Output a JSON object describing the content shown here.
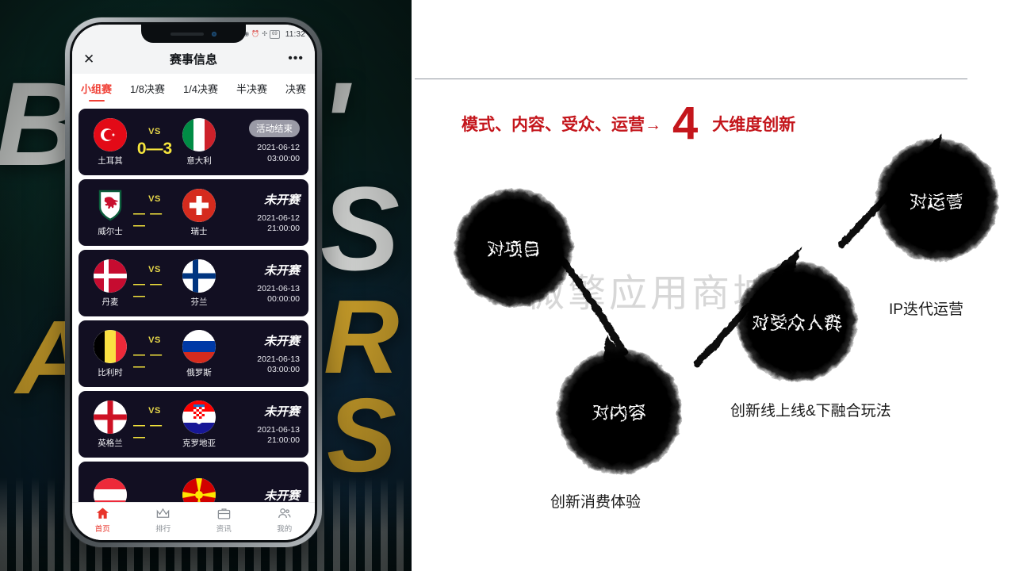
{
  "left_panel": {
    "background_words": [
      "B",
      "'",
      "S",
      "R",
      "S",
      "A"
    ],
    "phone": {
      "status_bar": {
        "time": "11:32",
        "battery": "69"
      },
      "nav": {
        "close_icon": "close-icon",
        "title": "赛事信息",
        "more_icon": "more-dots-icon"
      },
      "tabs": [
        {
          "label": "小组赛",
          "active": true
        },
        {
          "label": "1/8决赛",
          "active": false
        },
        {
          "label": "1/4决赛",
          "active": false
        },
        {
          "label": "半决赛",
          "active": false
        },
        {
          "label": "决赛",
          "active": false
        }
      ],
      "matches": [
        {
          "home": "土耳其",
          "away": "意大利",
          "home_flag": "turkey",
          "away_flag": "italy",
          "vs": "VS",
          "score": "0—3",
          "status": "活动结束",
          "status_type": "pill",
          "date": "2021-06-12",
          "time": "03:00:00"
        },
        {
          "home": "威尔士",
          "away": "瑞士",
          "home_flag": "wales",
          "away_flag": "switzerland",
          "vs": "VS",
          "score": "—  —  —",
          "status": "未开赛",
          "status_type": "text",
          "date": "2021-06-12",
          "time": "21:00:00"
        },
        {
          "home": "丹麦",
          "away": "芬兰",
          "home_flag": "denmark",
          "away_flag": "finland",
          "vs": "VS",
          "score": "—  —  —",
          "status": "未开赛",
          "status_type": "text",
          "date": "2021-06-13",
          "time": "00:00:00"
        },
        {
          "home": "比利时",
          "away": "俄罗斯",
          "home_flag": "belgium",
          "away_flag": "russia",
          "vs": "VS",
          "score": "—  —  —",
          "status": "未开赛",
          "status_type": "text",
          "date": "2021-06-13",
          "time": "03:00:00"
        },
        {
          "home": "英格兰",
          "away": "克罗地亚",
          "home_flag": "england",
          "away_flag": "croatia",
          "vs": "VS",
          "score": "—  —  —",
          "status": "未开赛",
          "status_type": "text",
          "date": "2021-06-13",
          "time": "21:00:00"
        }
      ],
      "tabbar": [
        {
          "label": "首页",
          "icon": "home-icon",
          "active": true
        },
        {
          "label": "排行",
          "icon": "crown-icon",
          "active": false
        },
        {
          "label": "资讯",
          "icon": "news-icon",
          "active": false
        },
        {
          "label": "我的",
          "icon": "user-icon",
          "active": false
        }
      ]
    }
  },
  "right_panel": {
    "title": {
      "lead": "模式、内容、受众、运营→",
      "number": "4",
      "trail": "大维度创新"
    },
    "watermark": "微擎应用商城",
    "nodes": [
      {
        "label": "对项目",
        "caption": ""
      },
      {
        "label": "对内容",
        "caption": "创新消费体验"
      },
      {
        "label": "对受众人群",
        "caption": "创新线上线&下融合玩法"
      },
      {
        "label": "对运营",
        "caption": "IP迭代运营"
      }
    ],
    "accent_color": "#c4161c"
  }
}
